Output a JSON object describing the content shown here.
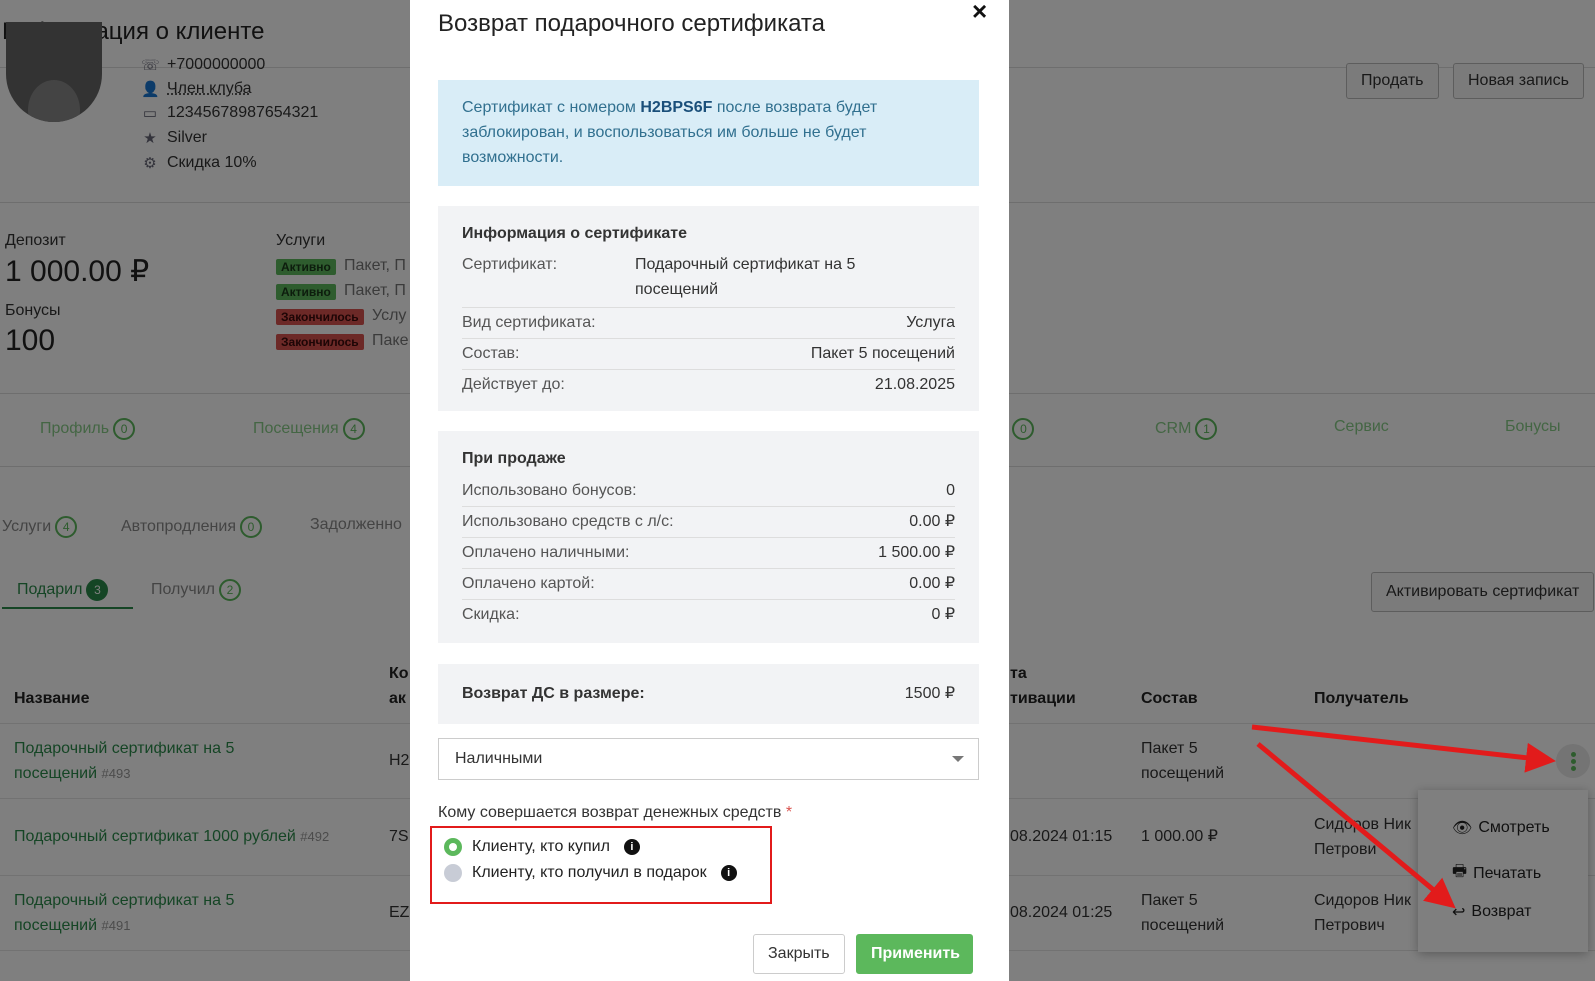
{
  "page": {
    "title": "Информация о клиенте",
    "client": {
      "phone_partial": "+7000000000",
      "club": "Член клуба",
      "card": "12345678987654321",
      "level": "Silver",
      "discount": "Скидка 10%"
    },
    "buttons": {
      "sell": "Продать",
      "new_entry": "Новая запись"
    },
    "deposit_label": "Депозит",
    "deposit_value": "1 000.00 ₽",
    "bonus_label": "Бонусы",
    "bonus_value": "100",
    "services_label": "Услуги",
    "services": [
      {
        "status": "Активно",
        "text": "Пакет, П"
      },
      {
        "status": "Активно",
        "text": "Пакет, П"
      },
      {
        "status": "Закончилось",
        "text": "Услу"
      },
      {
        "status": "Закончилось",
        "text": "Паке"
      }
    ],
    "main_tabs": [
      {
        "label": "Профиль",
        "count": "0"
      },
      {
        "label": "Посещения",
        "count": "4"
      },
      {
        "label": "",
        "count": "0"
      },
      {
        "label": "CRM",
        "count": "1"
      },
      {
        "label": "Сервис",
        "count": ""
      },
      {
        "label": "Бонусы",
        "count": ""
      }
    ],
    "sub_tabs": [
      {
        "label": "Услуги",
        "count": "4"
      },
      {
        "label": "Автопродления",
        "count": "0"
      },
      {
        "label": "Задолженно",
        "count": ""
      }
    ],
    "gift_tabs": [
      {
        "label": "Подарил",
        "count": "3"
      },
      {
        "label": "Получил",
        "count": "2"
      }
    ],
    "activate_button": "Активировать сертификат",
    "table_headers": {
      "name": "Название",
      "code_top": "Ко",
      "code_bottom": "ак",
      "date_top": "та",
      "date_bottom": "тивации",
      "content": "Состав",
      "recipient": "Получатель"
    },
    "rows": [
      {
        "name1": "Подарочный сертификат на 5",
        "name2": "посещений",
        "id": "#493",
        "code": "H2",
        "date": "",
        "content1": "Пакет 5",
        "content2": "посещений",
        "recipient1": "",
        "recipient2": ""
      },
      {
        "name1": "Подарочный сертификат 1000 рублей",
        "name2": "",
        "id": "#492",
        "code": "7S",
        "date": "08.2024 01:15",
        "content1": "1 000.00 ₽",
        "content2": "",
        "recipient1": "Сидоров Ник",
        "recipient2": "Петрови"
      },
      {
        "name1": "Подарочный сертификат на 5",
        "name2": "посещений",
        "id": "#491",
        "code": "EZ",
        "date": "08.2024 01:25",
        "content1": "Пакет 5",
        "content2": "посещений",
        "recipient1": "Сидоров Ник",
        "recipient2": "Петрович"
      }
    ],
    "context_menu": {
      "view": "Смотреть",
      "print": "Печатать",
      "refund": "Возврат"
    }
  },
  "modal": {
    "title": "Возврат подарочного сертификата",
    "alert_prefix": "Сертификат с номером ",
    "alert_code": "H2BPS6F",
    "alert_suffix": " после возврата будет заблокирован, и воспользоваться им больше не будет возможности.",
    "cert_info": {
      "heading": "Информация о сертификате",
      "certificate_label": "Сертификат:",
      "certificate_value1": "Подарочный сертификат на 5",
      "certificate_value2": "посещений",
      "type_label": "Вид сертификата:",
      "type_value": "Услуга",
      "content_label": "Состав:",
      "content_value": "Пакет 5 посещений",
      "valid_label": "Действует до:",
      "valid_value": "21.08.2025"
    },
    "sale_info": {
      "heading": "При продаже",
      "rows": [
        {
          "label": "Использовано бонусов:",
          "value": "0"
        },
        {
          "label": "Использовано средств с л/с:",
          "value": "0.00 ₽"
        },
        {
          "label": "Оплачено наличными:",
          "value": "1 500.00 ₽"
        },
        {
          "label": "Оплачено картой:",
          "value": "0.00 ₽"
        },
        {
          "label": "Скидка:",
          "value": "0 ₽"
        }
      ]
    },
    "refund": {
      "label": "Возврат ДС в размере:",
      "value": "1500 ₽"
    },
    "method_selected": "Наличными",
    "recipient_question": "Кому совершается возврат денежных средств",
    "required_mark": "*",
    "options": [
      {
        "label": "Клиенту, кто купил",
        "selected": true
      },
      {
        "label": "Клиенту, кто получил в подарок",
        "selected": false
      }
    ],
    "close_button": "Закрыть",
    "apply_button": "Применить"
  },
  "colors": {
    "accent": "#5cb85c",
    "link": "#2a8a4a",
    "annotation": "#e21b1b",
    "alert_bg": "#d9edf7"
  }
}
